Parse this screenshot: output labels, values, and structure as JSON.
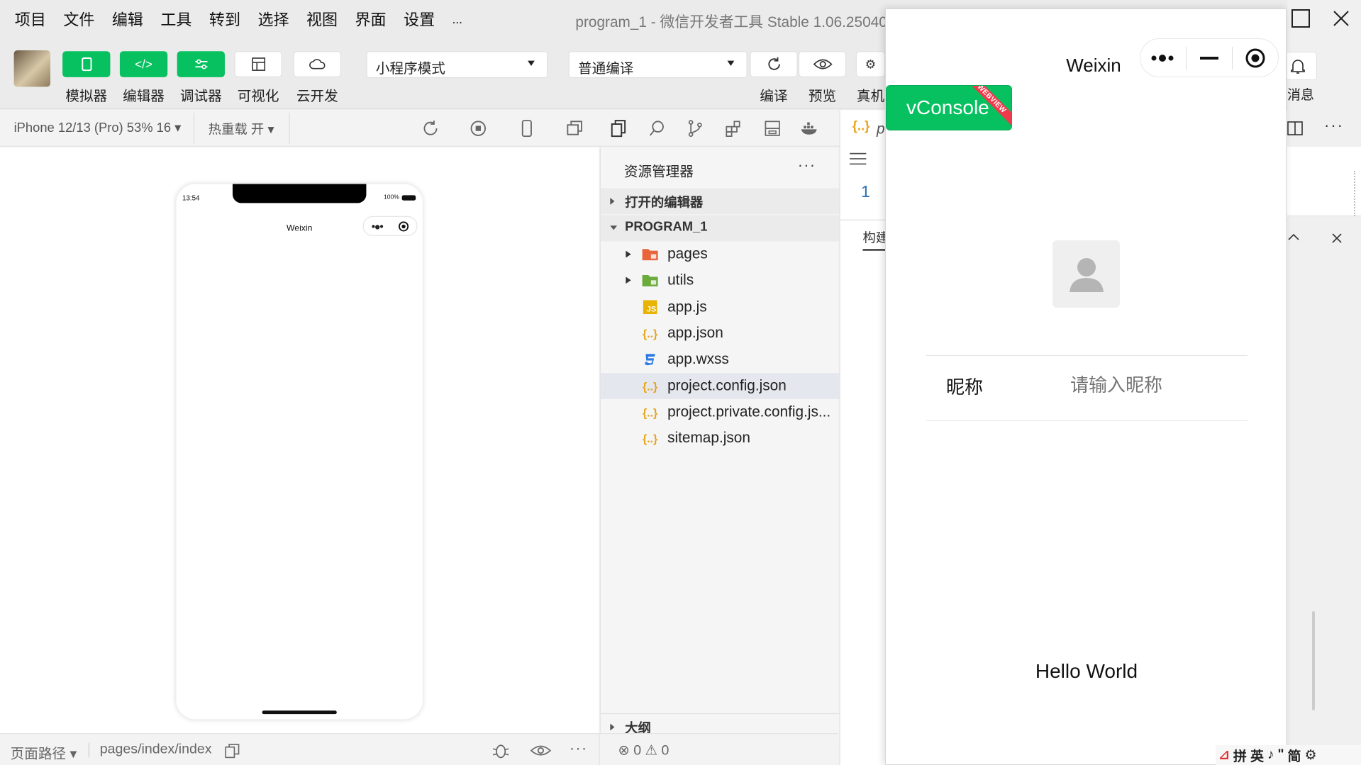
{
  "menu": [
    "项目",
    "文件",
    "编辑",
    "工具",
    "转到",
    "选择",
    "视图",
    "界面",
    "设置",
    "..."
  ],
  "window_title": "program_1 - 微信开发者工具 Stable 1.06.25040",
  "toolbar": {
    "simulator": "模拟器",
    "editor": "编辑器",
    "debugger": "调试器",
    "visual": "可视化",
    "cloud": "云开发",
    "mode_select": "小程序模式",
    "compile_select": "普通编译",
    "compile": "编译",
    "preview": "预览",
    "real_device": "真机",
    "messages": "消息"
  },
  "subbar": {
    "device": "iPhone 12/13 (Pro) 53% 16",
    "hot_reload": "热重载 开"
  },
  "simulator": {
    "time": "13:54",
    "battery": "100%",
    "nav_title": "Weixin"
  },
  "explorer": {
    "title": "资源管理器",
    "open_editors": "打开的编辑器",
    "project": "PROGRAM_1",
    "files": [
      {
        "name": "pages",
        "type": "folder"
      },
      {
        "name": "utils",
        "type": "folder"
      },
      {
        "name": "app.js",
        "type": "js"
      },
      {
        "name": "app.json",
        "type": "json"
      },
      {
        "name": "app.wxss",
        "type": "wxss"
      },
      {
        "name": "project.config.json",
        "type": "json"
      },
      {
        "name": "project.private.config.js...",
        "type": "json"
      },
      {
        "name": "sitemap.json",
        "type": "json"
      }
    ],
    "outline": "大纲"
  },
  "editor": {
    "tab_prefix": "p",
    "line_number": "1",
    "panel_tab": "构建"
  },
  "statusbar": {
    "page_path_label": "页面路径",
    "page_path": "pages/index/index",
    "errors": "0",
    "warnings": "0"
  },
  "preview_window": {
    "nav_title": "Weixin",
    "vconsole": "vConsole",
    "vconsole_badge": "WEBVIEW",
    "nickname_label": "昵称",
    "nickname_placeholder": "请输入昵称",
    "hello": "Hello World"
  },
  "ime": {
    "items": [
      "拼",
      "英",
      "♪",
      "\"",
      "简",
      "⚙"
    ]
  },
  "colors": {
    "accent": "#07c160",
    "badge": "#ee3b4b",
    "json_icon": "#e8a317",
    "js_icon": "#e8b400",
    "wxss_icon": "#2c7be5",
    "folder_pages": "#e8643b",
    "folder_utils": "#6aab3b"
  }
}
